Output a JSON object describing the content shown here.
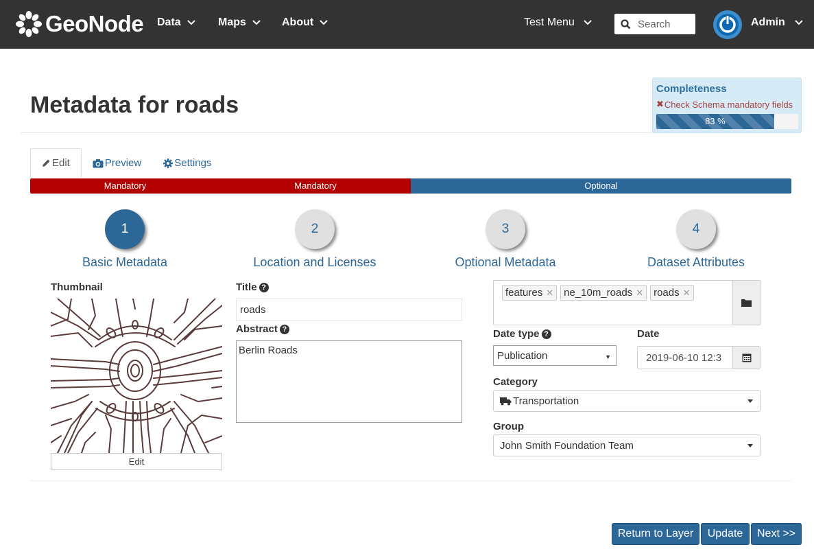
{
  "navbar": {
    "brand": "GeoNode",
    "menu": [
      {
        "label": "Data"
      },
      {
        "label": "Maps"
      },
      {
        "label": "About"
      }
    ],
    "test_menu": "Test Menu",
    "search_placeholder": "Search",
    "user": "Admin"
  },
  "page": {
    "title": "Metadata for roads"
  },
  "completeness": {
    "title": "Completeness",
    "warning": "Check Schema mandatory fields",
    "progress_percent": 83,
    "progress_label": "83 %"
  },
  "tabs": [
    {
      "label": "Edit",
      "active": true
    },
    {
      "label": "Preview",
      "active": false
    },
    {
      "label": "Settings",
      "active": false
    }
  ],
  "step_bar": [
    {
      "label": "Mandatory",
      "kind": "mandatory"
    },
    {
      "label": "Mandatory",
      "kind": "mandatory"
    },
    {
      "label": "Optional",
      "kind": "optional"
    }
  ],
  "steps": [
    {
      "number": "1",
      "label": "Basic Metadata",
      "active": true
    },
    {
      "number": "2",
      "label": "Location and Licenses",
      "active": false
    },
    {
      "number": "3",
      "label": "Optional Metadata",
      "active": false
    },
    {
      "number": "4",
      "label": "Dataset Attributes",
      "active": false
    }
  ],
  "form": {
    "thumbnail_label": "Thumbnail",
    "thumbnail_edit": "Edit",
    "title_label": "Title",
    "title_value": "roads",
    "abstract_label": "Abstract",
    "abstract_value": "Berlin Roads",
    "keywords": [
      "features",
      "ne_10m_roads",
      "roads"
    ],
    "date_type_label": "Date type",
    "date_type_value": "Publication",
    "date_label": "Date",
    "date_value": "2019-06-10 12:3",
    "category_label": "Category",
    "category_value": "Transportation",
    "group_label": "Group",
    "group_value": "John Smith Foundation Team"
  },
  "buttons": {
    "return": "Return to Layer",
    "update": "Update",
    "next": "Next >>"
  },
  "colors": {
    "navbar": "#333333",
    "primary": "#2c6798",
    "mandatory": "#b30000",
    "completeness_bg": "#d6ebf6",
    "warning": "#a94442"
  }
}
